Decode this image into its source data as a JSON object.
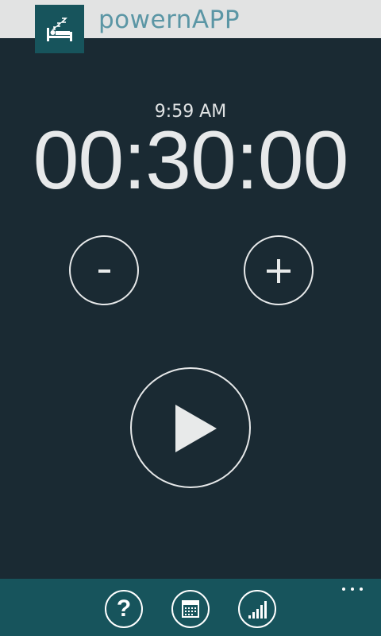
{
  "header": {
    "app_title": "powernAPP",
    "app_icon": "sleeping-bed-icon"
  },
  "clock": {
    "time": "9:59 AM"
  },
  "timer": {
    "value": "00:30:00"
  },
  "controls": {
    "decrease_label": "-",
    "increase_label": "+",
    "play_icon": "play-icon"
  },
  "app_bar": {
    "help_label": "?",
    "calendar_icon": "calendar-icon",
    "stats_icon": "signal-bars-icon",
    "more_icon": "more-dots-icon"
  },
  "colors": {
    "background": "#1a2a33",
    "accent": "#17545c",
    "header_bg": "#e2e3e3",
    "title_text": "#5b96a5",
    "foreground": "#e8eaea"
  }
}
